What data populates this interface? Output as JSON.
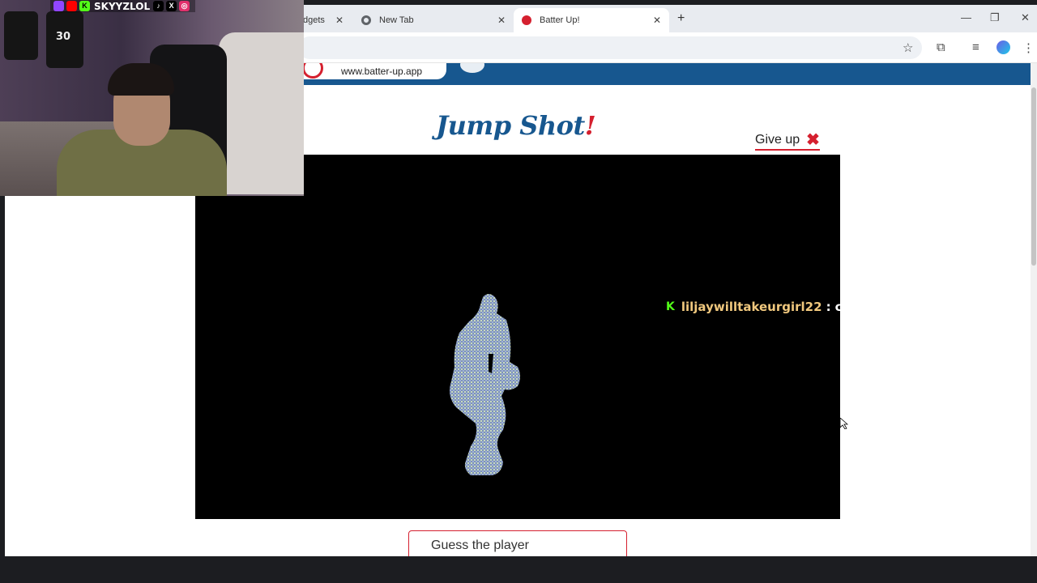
{
  "browser": {
    "tabs": [
      {
        "label": "dgets",
        "active": false
      },
      {
        "label": "New Tab",
        "active": false
      },
      {
        "label": "Batter Up!",
        "active": true
      }
    ],
    "close_glyph": "✕",
    "new_tab_glyph": "+",
    "window_controls": {
      "minimize": "—",
      "restore": "❐",
      "close": "✕"
    },
    "toolbar_icons": {
      "bookmark": "☆",
      "extensions": "⧉",
      "media": "≡",
      "menu": "⋮"
    }
  },
  "page": {
    "site_url": "www.batter-up.app",
    "game_title": "Jump Shot",
    "game_title_accent": "!",
    "give_up_label": "Give up",
    "give_up_icon": "✖",
    "guess_placeholder": "Guess the player",
    "accent_color": "#d5202f",
    "brand_color": "#17578f"
  },
  "chat_overlay": {
    "platform_icon": "K",
    "username": "liljaywilltakeurgirl22",
    "separator": ":",
    "message": "cj"
  },
  "webcam": {
    "handle": "SKYYZLOL",
    "social_icons": [
      "twitch-icon",
      "youtube-icon",
      "kick-icon",
      "tiktok-icon",
      "x-icon",
      "instagram-icon"
    ],
    "jersey_numbers": [
      "30"
    ]
  }
}
